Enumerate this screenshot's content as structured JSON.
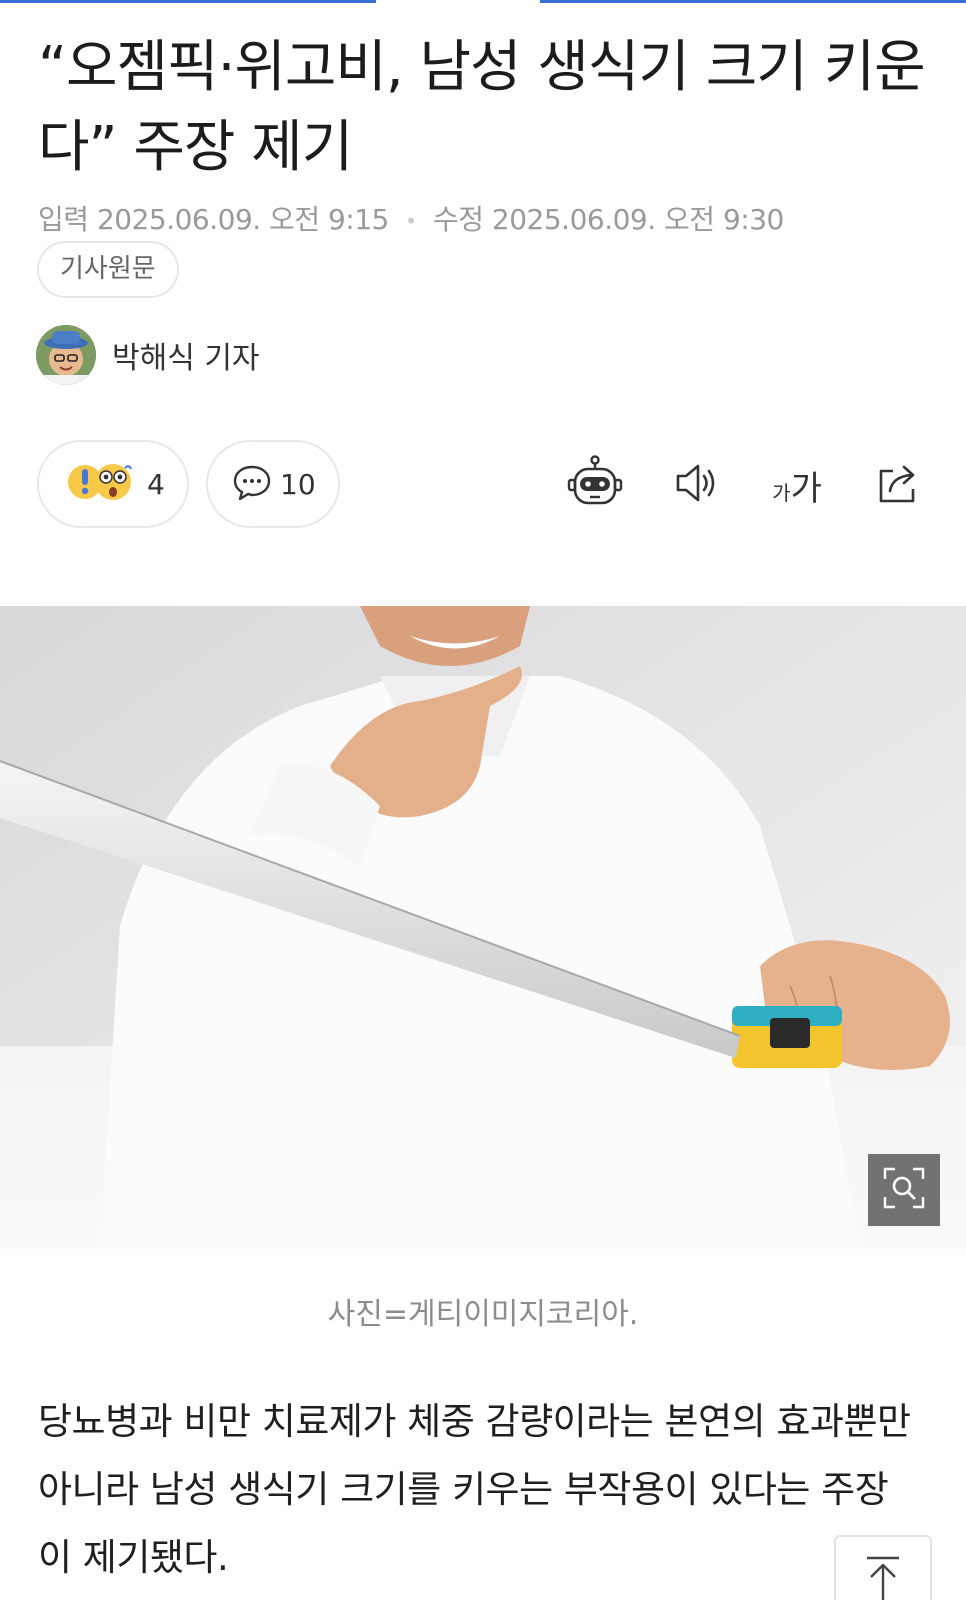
{
  "article": {
    "title": "“오젬픽·위고비, 남성 생식기 크기 키운다” 주장 제기",
    "published_label": "입력",
    "published_time": "2025.06.09. 오전 9:15",
    "modified_label": "수정",
    "modified_time": "2025.06.09. 오전 9:30",
    "original_button": "기사원문",
    "reporter": "박해식 기자",
    "caption": "사진=게티이미지코리아.",
    "body": "당뇨병과 비만 치료제가 체중 감량이라는 본연의 효과뿐만 아니라 남성 생식기 크기를 키우는 부작용이 있다는 주장이 제기됐다."
  },
  "actions": {
    "reaction_count": "4",
    "comment_count": "10",
    "font_size_label_small": "가",
    "font_size_label_large": "가"
  },
  "icons": {
    "reaction": "surprised-emoji-icon",
    "comment": "comment-bubble-icon",
    "summary_bot": "robot-icon",
    "tts": "speaker-icon",
    "share": "share-icon",
    "zoom": "magnifier-icon",
    "scroll_top": "arrow-up-icon"
  },
  "colors": {
    "accent": "#3b6fd8",
    "meta_text": "#9a9a9a"
  }
}
